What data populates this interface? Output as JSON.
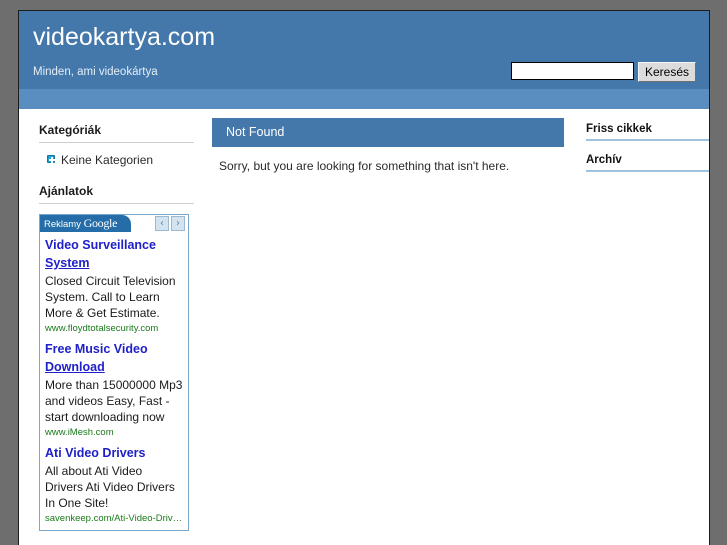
{
  "site": {
    "title": "videokartya.com",
    "tagline": "Minden, ami videokártya"
  },
  "search": {
    "value": "",
    "placeholder": "",
    "submit_label": "Keresés"
  },
  "sidebar_left": {
    "categories": {
      "heading": "Kategóriák",
      "items": [
        {
          "label": "Keine Kategorien",
          "icon": "plus-square-icon"
        }
      ]
    },
    "offers": {
      "heading": "Ajánlatok"
    },
    "ads": {
      "label_prefix": "Reklamy",
      "label_brand": "Google",
      "prev_icon": "‹",
      "next_icon": "›",
      "items": [
        {
          "title_line1": "Video Surveillance",
          "title_line2": "System",
          "description": "Closed Circuit Television System. Call to Learn More & Get Estimate.",
          "url": "www.floydtotalsecurity.com"
        },
        {
          "title_line1": "Free Music Video",
          "title_line2": "Download",
          "description": "More than 15000000 Mp3 and videos Easy, Fast - start downloading now",
          "url": "www.iMesh.com"
        },
        {
          "title_line1": "Ati Video Drivers",
          "title_line2": "",
          "description": "All about Ati Video Drivers Ati Video Drivers In One Site!",
          "url": "savenkeep.com/Ati-Video-Driv…"
        }
      ]
    }
  },
  "main": {
    "post_title": "Not Found",
    "post_body": "Sorry, but you are looking for something that isn't here."
  },
  "sidebar_right": {
    "headings": [
      {
        "label": "Friss cikkek"
      },
      {
        "label": "Archív"
      }
    ]
  },
  "colors": {
    "header_blue": "#4478ab",
    "band_blue": "#5b8ec0",
    "page_background": "#6e6e6e",
    "ad_title_blue": "#2020c8",
    "ad_url_green": "#1a7a1a",
    "bullet_blue": "#1f9ed8",
    "right_rule_blue": "#9fc2de"
  }
}
